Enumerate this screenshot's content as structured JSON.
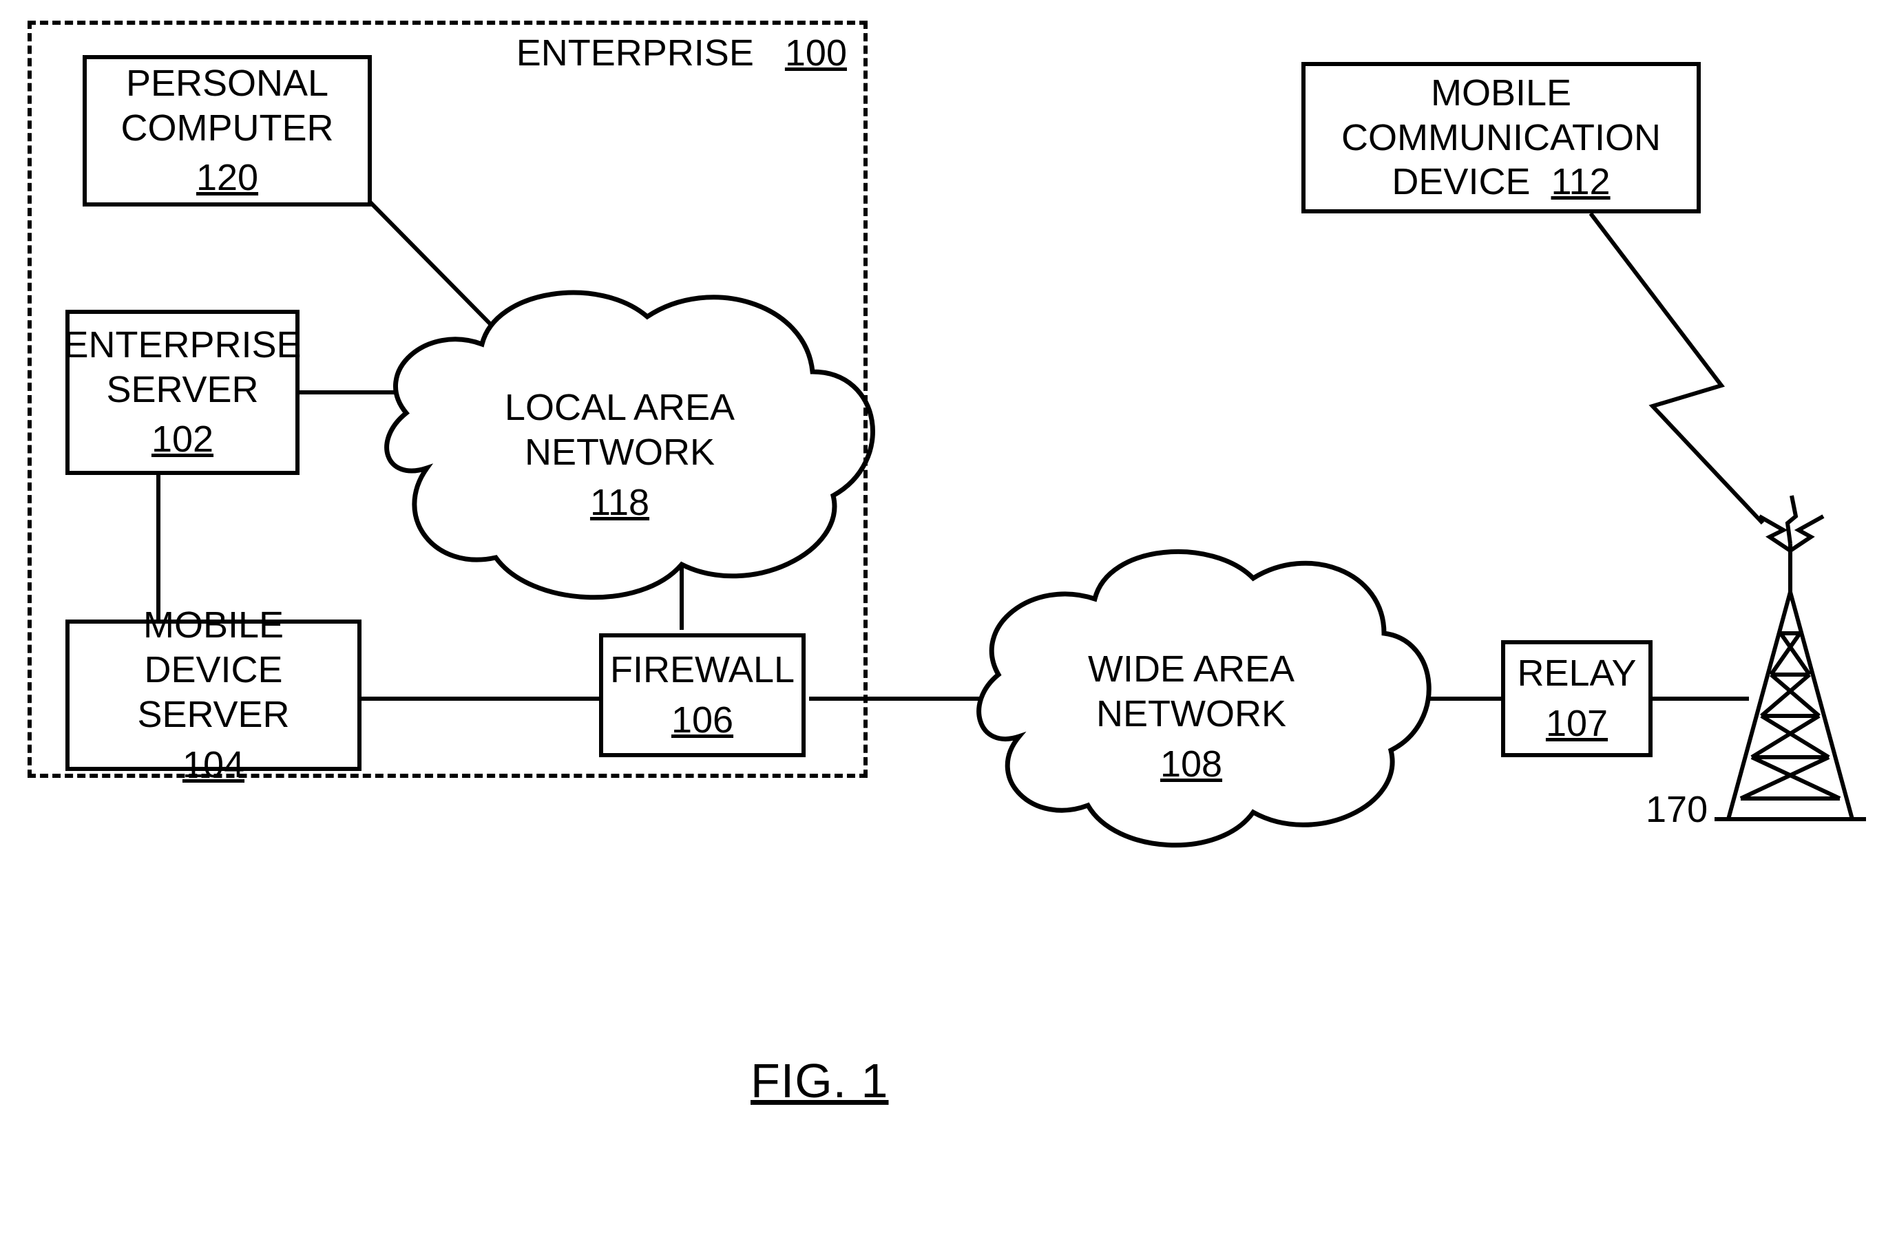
{
  "enterprise": {
    "label": "ENTERPRISE",
    "ref": "100",
    "personal_computer": {
      "label": "PERSONAL COMPUTER",
      "ref": "120"
    },
    "enterprise_server": {
      "label": "ENTERPRISE SERVER",
      "ref": "102"
    },
    "mobile_device_server": {
      "label": "MOBILE DEVICE SERVER",
      "ref": "104"
    },
    "lan": {
      "label": "LOCAL AREA NETWORK",
      "ref": "118"
    },
    "firewall": {
      "label": "FIREWALL",
      "ref": "106"
    }
  },
  "wan": {
    "label": "WIDE AREA NETWORK",
    "ref": "108"
  },
  "relay": {
    "label": "RELAY",
    "ref": "107"
  },
  "mobile_device": {
    "label": "MOBILE COMMUNICATION DEVICE",
    "ref": "112"
  },
  "tower": {
    "ref": "170"
  },
  "figure": {
    "caption": "FIG. 1"
  }
}
